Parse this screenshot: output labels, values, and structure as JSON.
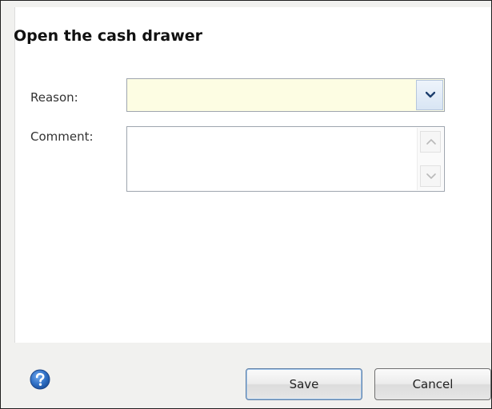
{
  "dialog": {
    "title": "Open the cash drawer"
  },
  "form": {
    "reason_label": "Reason:",
    "reason_value": "",
    "comment_label": "Comment:",
    "comment_value": ""
  },
  "footer": {
    "help_icon": "help-icon",
    "save_label": "Save",
    "cancel_label": "Cancel"
  },
  "colors": {
    "reason_field_bg": "#fdfde3",
    "help_icon_blue": "#2f6fc4"
  }
}
